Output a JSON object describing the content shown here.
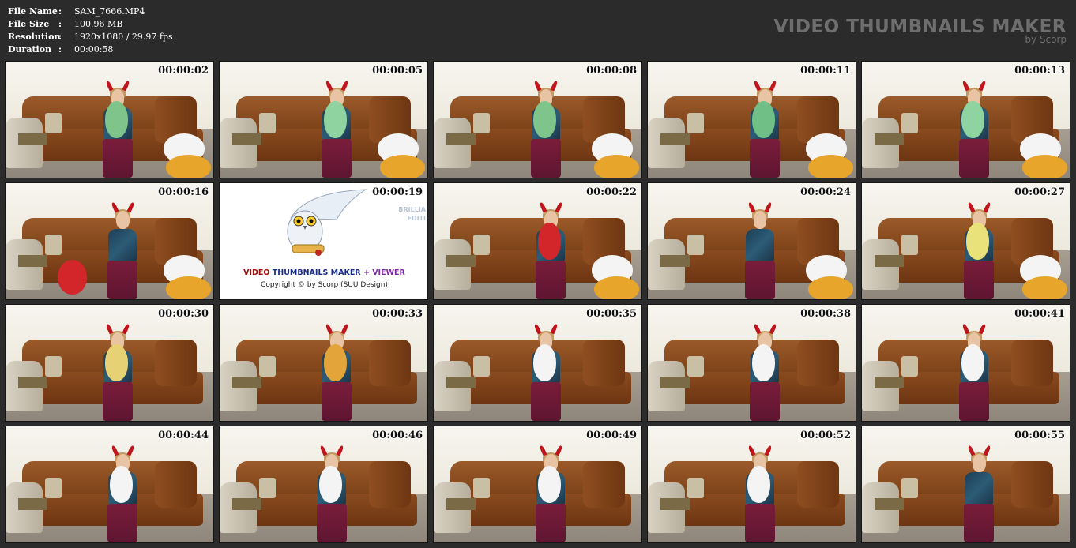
{
  "info": {
    "rows": [
      {
        "label": "File Name",
        "value": "SAM_7666.MP4"
      },
      {
        "label": "File Size",
        "value": "100.96 MB"
      },
      {
        "label": "Resolution",
        "value": "1920x1080 / 29.97 fps"
      },
      {
        "label": "Duration",
        "value": "00:00:58"
      }
    ],
    "colon": ":"
  },
  "brand": {
    "title": "VIDEO THUMBNAILS MAKER",
    "subtitle": "by Scorp"
  },
  "logo_frame": {
    "title_part1": "VIDEO",
    "title_part2": "THUMBNAILS MAKER",
    "title_part3": "+ VIEWER",
    "copyright": "Copyright © by Scorp (SUU Design)",
    "side_text": "BRILLIA\nEDITI"
  },
  "thumbnails": [
    {
      "time": "00:00:02",
      "balloon": "#7fc48a"
    },
    {
      "time": "00:00:05",
      "balloon": "#8fd3a0"
    },
    {
      "time": "00:00:08",
      "balloon": "#7fc48a"
    },
    {
      "time": "00:00:11",
      "balloon": "#6fbf86"
    },
    {
      "time": "00:00:13",
      "balloon": "#8fd3a0"
    },
    {
      "time": "00:00:16",
      "balloon": "#d2262b"
    },
    {
      "time": "00:00:19",
      "logo": true
    },
    {
      "time": "00:00:22",
      "balloon": "#d2262b"
    },
    {
      "time": "00:00:24",
      "balloon": ""
    },
    {
      "time": "00:00:27",
      "balloon": "#e9e27a"
    },
    {
      "time": "00:00:30",
      "balloon": "#e6d274"
    },
    {
      "time": "00:00:33",
      "balloon": "#e3a53a"
    },
    {
      "time": "00:00:35",
      "balloon": "#f4f4f4"
    },
    {
      "time": "00:00:38",
      "balloon": "#f4f4f4"
    },
    {
      "time": "00:00:41",
      "balloon": "#f4f4f4"
    },
    {
      "time": "00:00:44",
      "balloon": "#f4f4f4"
    },
    {
      "time": "00:00:46",
      "balloon": "#f4f4f4"
    },
    {
      "time": "00:00:49",
      "balloon": "#f4f4f4"
    },
    {
      "time": "00:00:52",
      "balloon": "#f4f4f4"
    },
    {
      "time": "00:00:55",
      "balloon": ""
    }
  ]
}
